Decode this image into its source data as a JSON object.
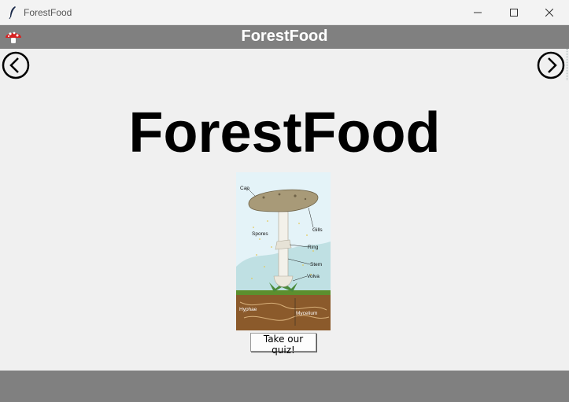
{
  "window": {
    "title": "ForestFood"
  },
  "header": {
    "title": "ForestFood"
  },
  "main": {
    "title": "ForestFood"
  },
  "diagram": {
    "labels": {
      "cap": "Cap",
      "spores": "Spores",
      "gills": "Gills",
      "ring": "Ring",
      "stem": "Stem",
      "volva": "Volva",
      "hyphae": "Hyphae",
      "mycelium": "Mycelium"
    }
  },
  "quiz": {
    "label": "Take our quiz!"
  },
  "icons": {
    "app": "feather-icon",
    "logo": "mushroom-icon",
    "prev": "arrow-left-circle-icon",
    "next": "arrow-right-circle-icon"
  },
  "colors": {
    "header_bg": "#808080",
    "body_bg": "#f0f0f0",
    "footer_bg": "#808080"
  }
}
